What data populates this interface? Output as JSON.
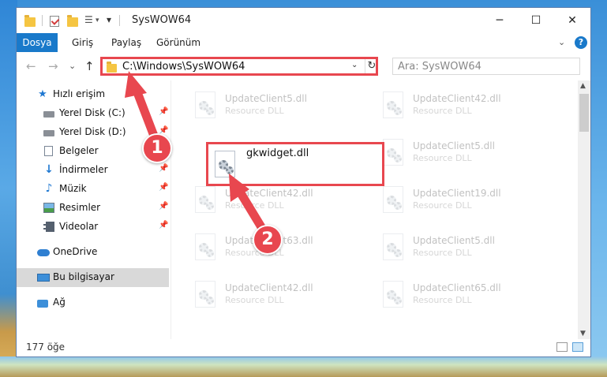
{
  "window": {
    "title": "SysWOW64",
    "minimize_glyph": "─",
    "maximize_glyph": "☐",
    "close_glyph": "✕"
  },
  "ribbon": {
    "tabs": [
      "Dosya",
      "Giriş",
      "Paylaş",
      "Görünüm"
    ],
    "expand_glyph": "⌄",
    "help_glyph": "?"
  },
  "address": {
    "path": "C:\\Windows\\SysWOW64",
    "dropdown_glyph": "⌄",
    "refresh_glyph": "↻",
    "search_placeholder": "Ara: SysWOW64"
  },
  "nav_buttons": {
    "back": "←",
    "forward": "→",
    "recent": "⌄",
    "up": "↑"
  },
  "sidebar": {
    "quick_access": "Hızlı erişim",
    "items": [
      {
        "label": "Yerel Disk (C:)",
        "pinned": true
      },
      {
        "label": "Yerel Disk (D:)",
        "pinned": true
      },
      {
        "label": "Belgeler",
        "pinned": true
      },
      {
        "label": "İndirmeler",
        "pinned": true
      },
      {
        "label": "Müzik",
        "pinned": true
      },
      {
        "label": "Resimler",
        "pinned": true
      },
      {
        "label": "Videolar",
        "pinned": true
      }
    ],
    "onedrive": "OneDrive",
    "this_pc": "Bu bilgisayar",
    "network": "Ağ",
    "pin_glyph": "📌"
  },
  "files": {
    "left": [
      {
        "name": "UpdateClient5.dll",
        "type": "Resource DLL"
      },
      {
        "name": "UpdateClient42.dll",
        "type": "Resource DLL"
      },
      {
        "name": "UpdateClient63.dll",
        "type": "Resource DLL"
      },
      {
        "name": "UpdateClient42.dll",
        "type": "Resource DLL"
      }
    ],
    "right": [
      {
        "name": "UpdateClient42.dll",
        "type": "Resource DLL"
      },
      {
        "name": "UpdateClient5.dll",
        "type": "Resource DLL"
      },
      {
        "name": "UpdateClient19.dll",
        "type": "Resource DLL"
      },
      {
        "name": "UpdateClient5.dll",
        "type": "Resource DLL"
      },
      {
        "name": "UpdateClient65.dll",
        "type": "Resource DLL"
      }
    ],
    "highlighted": {
      "name": "gkwidget.dll"
    }
  },
  "status": {
    "item_count": "177 öğe"
  },
  "annotations": {
    "step1": "1",
    "step2": "2",
    "color": "#e8474f"
  },
  "scroll": {
    "up": "▲",
    "down": "▼"
  }
}
